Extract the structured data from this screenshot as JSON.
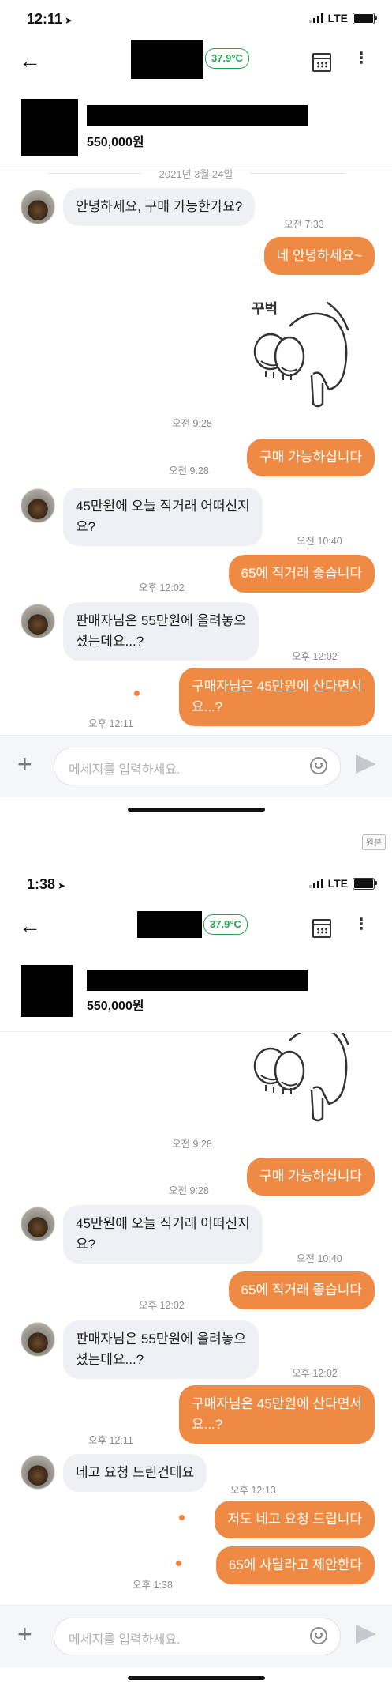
{
  "screen1": {
    "status": {
      "time": "12:11",
      "network": "LTE"
    },
    "header": {
      "temperature": "37.9°C",
      "calendar_icon": "calendar-icon",
      "more_icon": "more-vert-icon"
    },
    "product": {
      "price": "550,000원"
    },
    "date_divider": "2021년 3월 24일",
    "messages": {
      "m1": "안녕하세요, 구매 가능한가요?",
      "m1_time": "오전 7:33",
      "m2": "네 안녕하세요~",
      "sticker_text": "꾸벅",
      "sticker_time": "오전 9:28",
      "m3": "구매 가능하십니다",
      "m3_time": "오전 9:28",
      "m4": "45만원에 오늘 직거래 어떠신지\n요?",
      "m4_time": "오전 10:40",
      "m5": "65에 직거래 좋습니다",
      "m5_time": "오후 12:02",
      "m6": "판매자님은 55만원에 올려놓으\n셨는데요...?",
      "m6_time": "오후 12:02",
      "m7": "구매자님은 45만원에 산다면서\n요...?",
      "m7_time": "오후 12:11"
    },
    "composer": {
      "placeholder": "메세지를 입력하세요."
    }
  },
  "original_label": "원본",
  "screen2": {
    "status": {
      "time": "1:38",
      "network": "LTE"
    },
    "header": {
      "temperature": "37.9°C"
    },
    "product": {
      "price": "550,000원"
    },
    "messages": {
      "sticker_time": "오전 9:28",
      "m3": "구매 가능하십니다",
      "m3_time": "오전 9:28",
      "m4": "45만원에 오늘 직거래 어떠신지\n요?",
      "m4_time": "오전 10:40",
      "m5": "65에 직거래 좋습니다",
      "m5_time": "오후 12:02",
      "m6": "판매자님은 55만원에 올려놓으\n셨는데요...?",
      "m6_time": "오후 12:02",
      "m7": "구매자님은 45만원에 산다면서\n요...?",
      "m7_time": "오후 12:11",
      "m8": "네고 요청 드린건데요",
      "m8_time": "오후 12:13",
      "m9": "저도 네고 요청 드립니다",
      "m10": "65에 사달라고 제안한다",
      "m10_time": "오후 1:38"
    },
    "composer": {
      "placeholder": "메세지를 입력하세요."
    }
  }
}
